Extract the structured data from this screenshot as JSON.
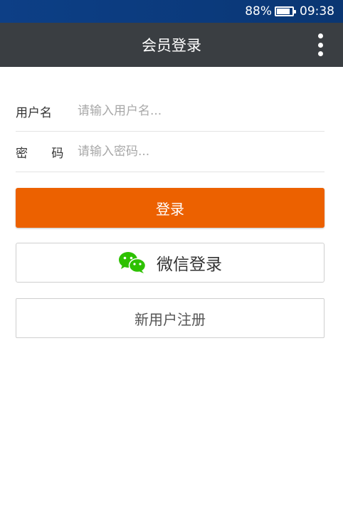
{
  "status_bar": {
    "battery_percent": "88%",
    "time": "09:38",
    "battery_level": 0.88
  },
  "header": {
    "title": "会员登录",
    "menu_icon": "more-vertical-icon"
  },
  "form": {
    "username_label": "用户名",
    "username_placeholder": "请输入用户名...",
    "username_value": "",
    "password_label": "密 码",
    "password_placeholder": "请输入密码...",
    "password_value": ""
  },
  "buttons": {
    "login_label": "登录",
    "wechat_label": "微信登录",
    "wechat_icon": "wechat-icon",
    "register_label": "新用户注册"
  },
  "colors": {
    "status_bar": "#0d3f86",
    "title_bar": "#3a3e42",
    "login_button": "#ec6100",
    "wechat_green": "#2dc100"
  }
}
